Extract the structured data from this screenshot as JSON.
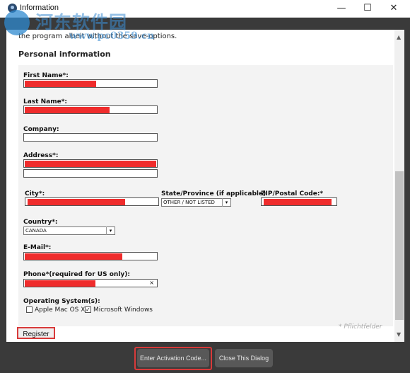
{
  "window": {
    "title": "Information",
    "controls": {
      "minimize": "—",
      "maximize": "☐",
      "close": "✕"
    }
  },
  "watermark": {
    "text": "河东软件园",
    "url": "www.pc0359.cn"
  },
  "intro_text": "the program albeit without the save-options.",
  "section_title": "Personal information",
  "form": {
    "first_name_label": "First Name*:",
    "last_name_label": "Last Name*:",
    "company_label": "Company:",
    "address_label": "Address*:",
    "city_label": "City*:",
    "state_label": "State/Province (if applicable)",
    "state_value": "OTHER / NOT LISTED",
    "zip_label": "ZIP/Postal Code:*",
    "country_label": "Country*:",
    "country_value": "CANADA",
    "email_label": "E-Mail*:",
    "phone_label": "Phone*(required for US only):",
    "phone_clear": "×",
    "os_label": "Operating System(s):",
    "os_options": [
      {
        "label": "Apple Mac OS X",
        "checked": false
      },
      {
        "label": "Microsoft Windows",
        "checked": true
      }
    ],
    "required_note": "* Pflichtfelder"
  },
  "buttons": {
    "register": "Register",
    "enter_activation": "Enter Activation Code...",
    "close_dialog": "Close This Dialog"
  },
  "colors": {
    "redaction": "#ef2c2c",
    "highlight": "#d83a3a"
  }
}
